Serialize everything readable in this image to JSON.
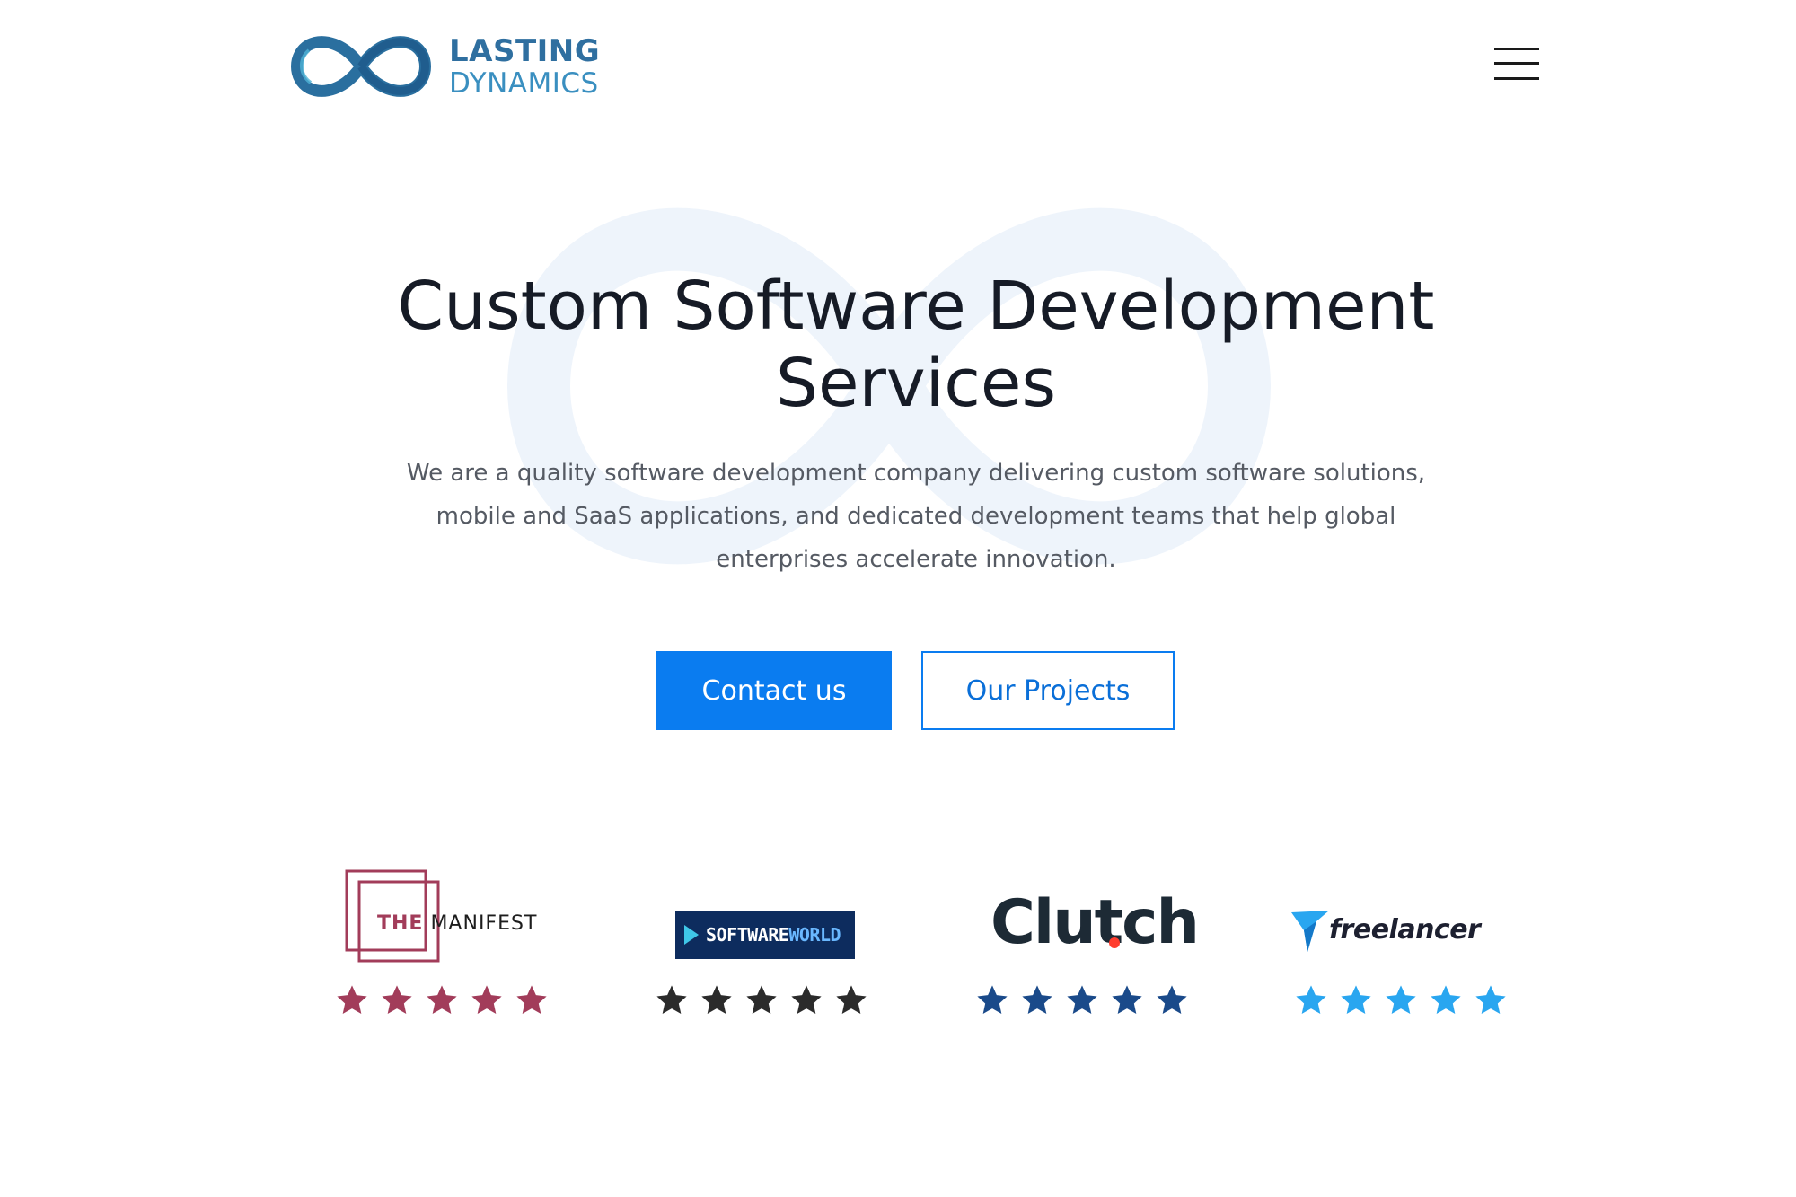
{
  "header": {
    "logo": {
      "word1": "LASTING",
      "word2": "DYNAMICS",
      "icon": "infinity-logo-icon",
      "colors": [
        "#1f5f8f",
        "#3aa0c8"
      ]
    },
    "menu_icon": "hamburger-menu-icon"
  },
  "hero": {
    "title_line1": "Custom Software Development",
    "title_line2": "Services",
    "subtitle_line1": "We are a quality software development company delivering custom software solutions,",
    "subtitle_line2": "mobile and SaaS applications, and dedicated development teams that help global",
    "subtitle_line3": "enterprises accelerate innovation.",
    "buttons": {
      "primary": "Contact us",
      "secondary": "Our Projects"
    },
    "accent_color": "#0a7cf0"
  },
  "reviews": [
    {
      "platform": "THE MANIFEST",
      "the": "THE",
      "rest": "MANIFEST",
      "stars": 5,
      "star_color": "#a23c5a",
      "icon": "manifest-logo-icon"
    },
    {
      "platform": "SOFTWAREWORLD",
      "part1": "SOFTWARE",
      "part2": "WORLD",
      "stars": 5,
      "star_color": "#2b2b2b",
      "icon": "softwareworld-logo-icon"
    },
    {
      "platform": "Clutch",
      "stars": 5,
      "star_color": "#1a4a8a",
      "icon": "clutch-logo-icon"
    },
    {
      "platform": "freelancer",
      "stars": 5,
      "star_color": "#29a6f0",
      "icon": "freelancer-logo-icon"
    }
  ]
}
